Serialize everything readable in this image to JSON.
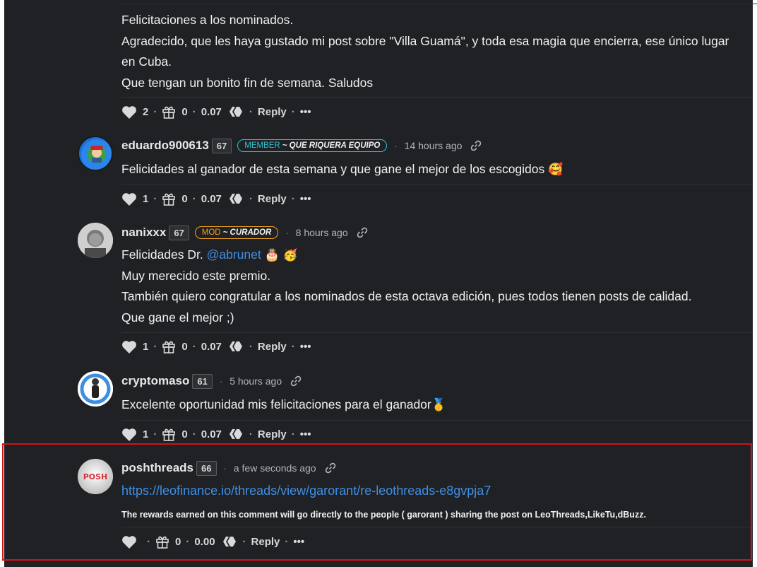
{
  "comments": [
    {
      "lines": [
        "Felicitaciones a los nominados.",
        "Agradecido, que les haya gustado mi post sobre \"Villa Guamá\", y toda esa magia que encierra, ese único lugar en Cuba.",
        "Que tengan un bonito fin de semana. Saludos"
      ],
      "votes": "2",
      "gifts": "0",
      "payout": "0.07",
      "reply": "Reply",
      "more": "•••"
    },
    {
      "username": "eduardo900613",
      "rep": "67",
      "badge_role": "MEMBER",
      "badge_title": "~ QUE RIQUERA EQUIPO",
      "time": "14 hours ago",
      "text": "Felicidades al ganador de esta semana y que gane el mejor de los escogidos",
      "emoji": "🥰",
      "votes": "1",
      "gifts": "0",
      "payout": "0.07",
      "reply": "Reply",
      "more": "•••"
    },
    {
      "username": "nanixxx",
      "rep": "67",
      "badge_role": "MOD",
      "badge_title": "~ CURADOR",
      "time": "8 hours ago",
      "line1_prefix": "Felicidades Dr. ",
      "line1_mention": "@abrunet",
      "line1_emoji": "🎂 🥳",
      "lines": [
        "Muy merecido este premio.",
        "También quiero congratular a los nominados de esta octava edición, pues todos tienen posts de calidad.",
        "Que gane el mejor ;)"
      ],
      "votes": "1",
      "gifts": "0",
      "payout": "0.07",
      "reply": "Reply",
      "more": "•••"
    },
    {
      "username": "cryptomaso",
      "rep": "61",
      "time": "5 hours ago",
      "text": "Excelente oportunidad mis felicitaciones para el ganador",
      "emoji": "🥇",
      "votes": "1",
      "gifts": "0",
      "payout": "0.07",
      "reply": "Reply",
      "more": "•••"
    },
    {
      "username": "poshthreads",
      "rep": "66",
      "avatar_text": "POSH",
      "time": "a few seconds ago",
      "link": "https://leofinance.io/threads/view/garorant/re-leothreads-e8gvpja7",
      "note": "The rewards earned on this comment will go directly to the people ( garorant ) sharing the post on LeoThreads,LikeTu,dBuzz.",
      "gifts": "0",
      "payout": "0.00",
      "reply": "Reply",
      "more": "•••"
    }
  ],
  "colors": {
    "accent_link": "#3f8fe6",
    "member_badge": "#2fc4d5",
    "mod_badge": "#f0a020",
    "highlight_box": "#d21414"
  },
  "icons": [
    "heart-icon",
    "gift-icon",
    "hive-icon",
    "link-icon"
  ]
}
